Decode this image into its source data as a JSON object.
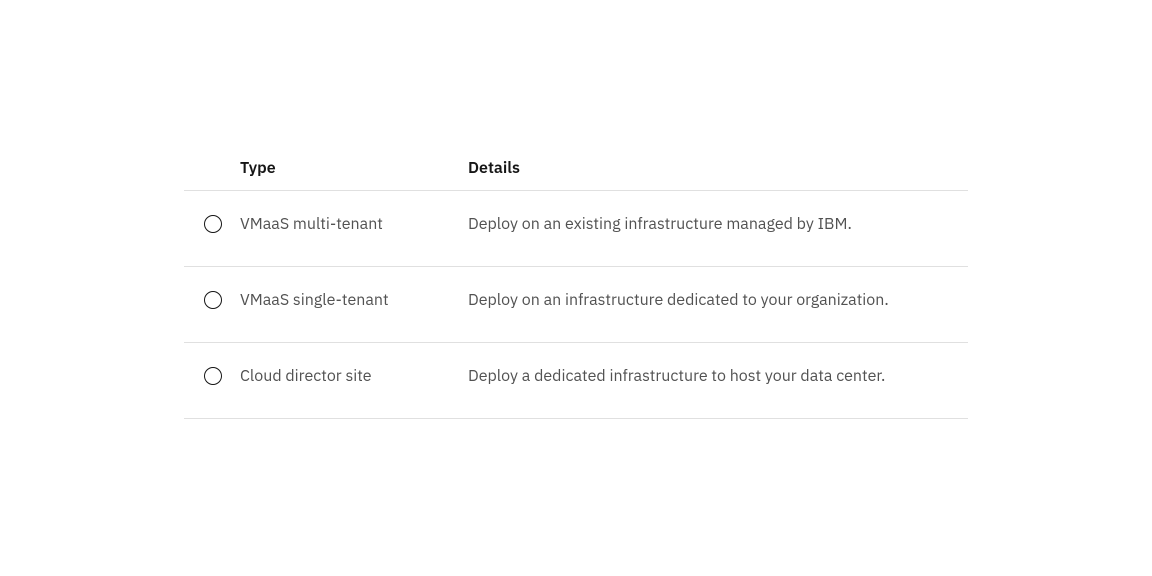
{
  "table": {
    "headers": {
      "type": "Type",
      "details": "Details"
    },
    "rows": [
      {
        "type": "VMaaS multi-tenant",
        "details": "Deploy on an existing infrastructure managed by IBM."
      },
      {
        "type": "VMaaS single-tenant",
        "details": "Deploy on an infrastructure dedicated to your organization."
      },
      {
        "type": "Cloud director site",
        "details": "Deploy a dedicated infrastructure to host your data center."
      }
    ]
  }
}
